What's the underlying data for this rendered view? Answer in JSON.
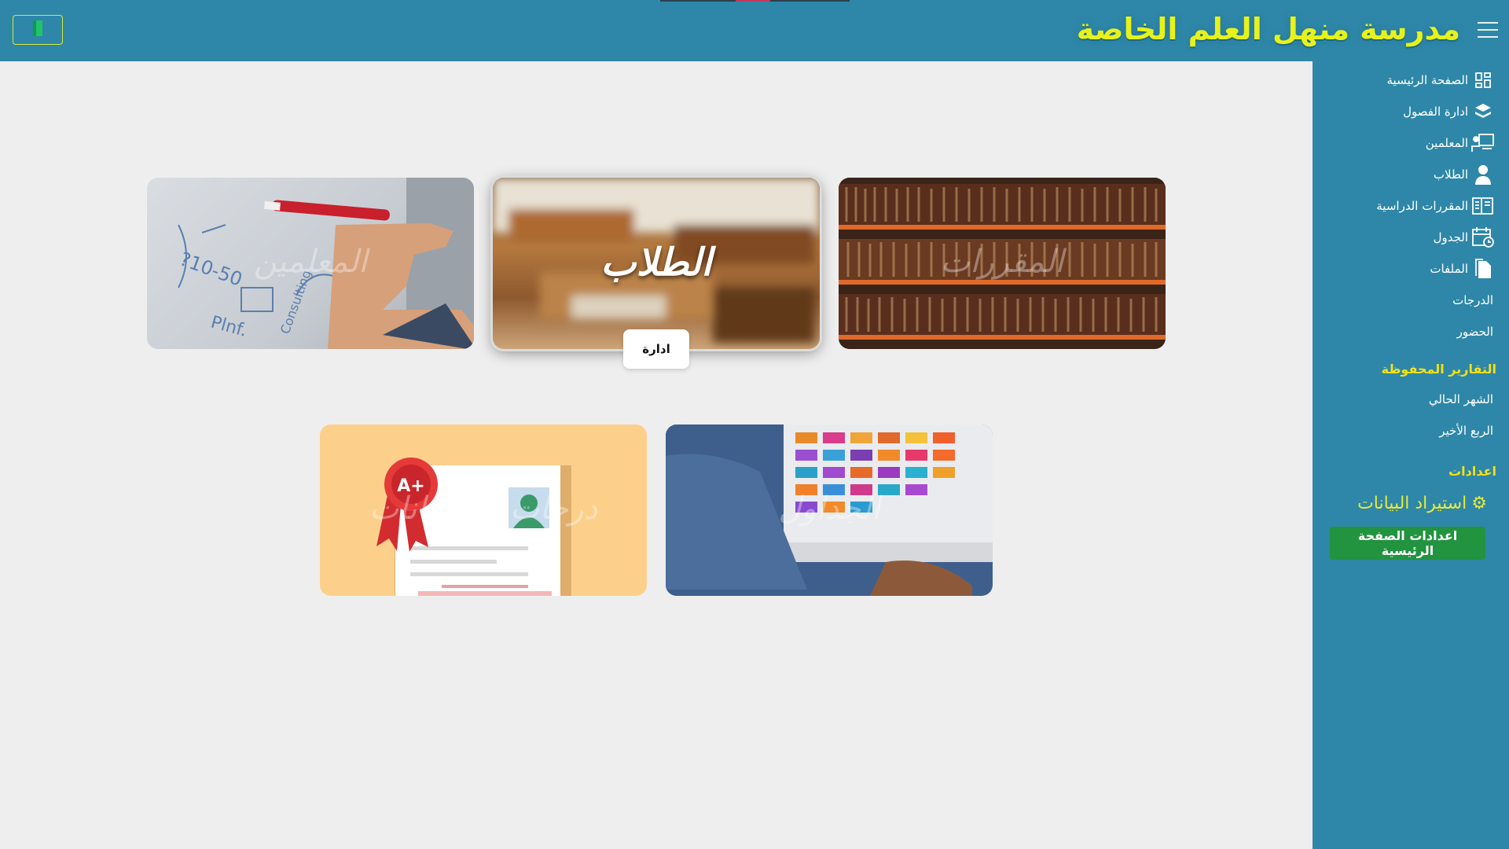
{
  "header": {
    "school_name": "مدرسة منهل العلم الخاصة",
    "exit_icon": "door-exit-icon",
    "menu_icon": "hamburger-icon"
  },
  "sidebar": {
    "items": [
      {
        "label": "الصفحة الرئيسية",
        "icon": "dashboard-grid-icon"
      },
      {
        "label": "ادارة الفصول",
        "icon": "layers-icon"
      },
      {
        "label": "المعلمين",
        "icon": "teacher-board-icon"
      },
      {
        "label": "الطلاب",
        "icon": "student-user-icon"
      },
      {
        "label": "المقررات الدراسية",
        "icon": "open-book-icon"
      },
      {
        "label": "الجدول",
        "icon": "calendar-clock-icon"
      },
      {
        "label": "الملفات",
        "icon": "files-icon"
      },
      {
        "label": "الدرجات",
        "icon": ""
      },
      {
        "label": "الحضور",
        "icon": ""
      }
    ],
    "saved_reports": {
      "title": "التقارير المحفوظة",
      "items": [
        "الشهر الحالي",
        "الربع الأخير"
      ]
    },
    "settings": {
      "title": "اعدادات",
      "restore_label": "استيراد البيانات",
      "home_settings_label": "اعدادات الصفحة الرئيسية"
    }
  },
  "cards": {
    "books": {
      "title": "المقررات"
    },
    "students": {
      "title": "الطلاب",
      "action_label": "ادارة"
    },
    "teachers": {
      "title": "المعلمين"
    },
    "schedule": {
      "title": "الجداول"
    },
    "grades": {
      "title": "درجات الامتحانات"
    }
  },
  "colors": {
    "primary": "#2e87a8",
    "title_yellow": "#e8f21a",
    "section_yellow": "#f2e01a",
    "button_green": "#22933f",
    "page_bg": "#eeeeee"
  }
}
